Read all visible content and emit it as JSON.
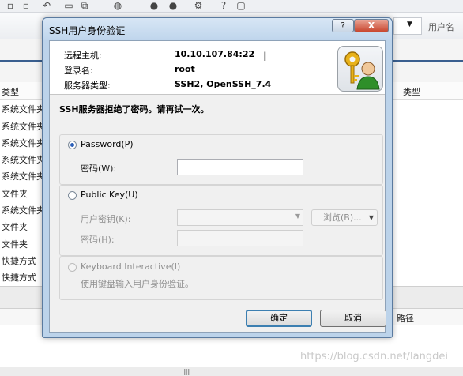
{
  "background": {
    "right_header_label": "用户名",
    "list_column_header": "类型",
    "list_rows": [
      "系统文件夹",
      "系统文件夹",
      "系统文件夹",
      "系统文件夹",
      "系统文件夹",
      "文件夹",
      "系统文件夹",
      "文件夹",
      "文件夹",
      "快捷方式",
      "快捷方式"
    ],
    "right_column_header": "类型",
    "bottom_path_column": "路径",
    "watermark": "https://blog.csdn.net/langdei"
  },
  "dialog": {
    "title": "SSH用户身份验证",
    "help_label": "?",
    "close_label": "X",
    "info": [
      {
        "label": "远程主机:",
        "value": "10.10.107.84:22"
      },
      {
        "label": "登录名:",
        "value": "root"
      },
      {
        "label": "服务器类型:",
        "value": "SSH2, OpenSSH_7.4"
      }
    ],
    "error_message": "SSH服务器拒绝了密码。请再试一次。",
    "password_option": {
      "label": "Password(P)",
      "checked": true,
      "field_label": "密码(W):",
      "value": ""
    },
    "public_key_option": {
      "label": "Public Key(U)",
      "checked": false,
      "user_key_label": "用户密钥(K):",
      "browse_label": "浏览(B)...",
      "passphrase_label": "密码(H):"
    },
    "keyboard_option": {
      "label": "Keyboard Interactive(I)",
      "checked": false,
      "description": "使用键盘输入用户身份验证。"
    },
    "ok_label": "确定",
    "cancel_label": "取消"
  }
}
